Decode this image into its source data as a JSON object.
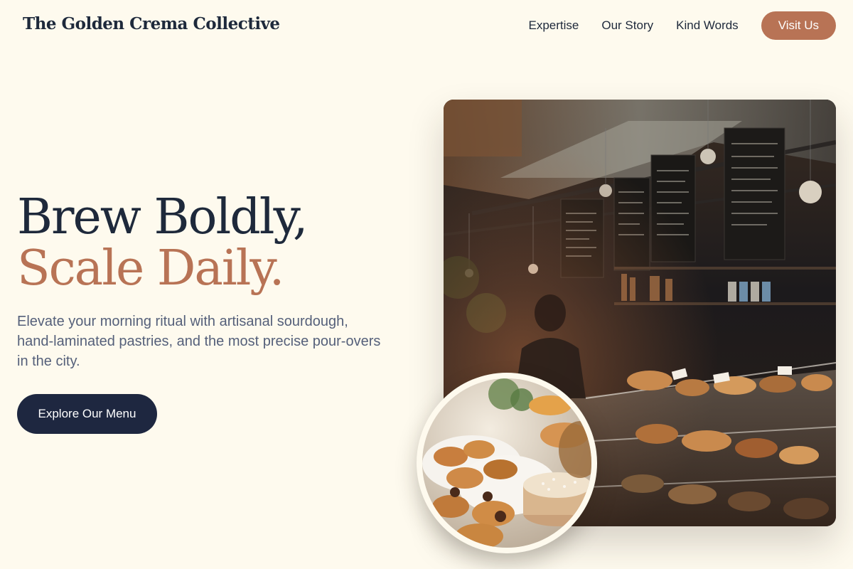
{
  "brand": {
    "name": "The Golden Crema Collective"
  },
  "nav": {
    "links": [
      "Expertise",
      "Our Story",
      "Kind Words"
    ],
    "visit_label": "Visit Us"
  },
  "hero": {
    "title_line1": "Brew Boldly,",
    "title_line2": "Scale Daily.",
    "subtitle": "Elevate your morning ritual with artisanal sourdough, hand-laminated pastries, and the most precise pour-overs in the city.",
    "cta_label": "Explore Our Menu"
  },
  "colors": {
    "background": "#fefaee",
    "primary_dark": "#1e2740",
    "accent": "#b87355",
    "body_text": "#55607a"
  },
  "icons": {
    "main_photo": "bakery-interior-photo",
    "secondary_photo": "pastries-closeup-photo"
  }
}
